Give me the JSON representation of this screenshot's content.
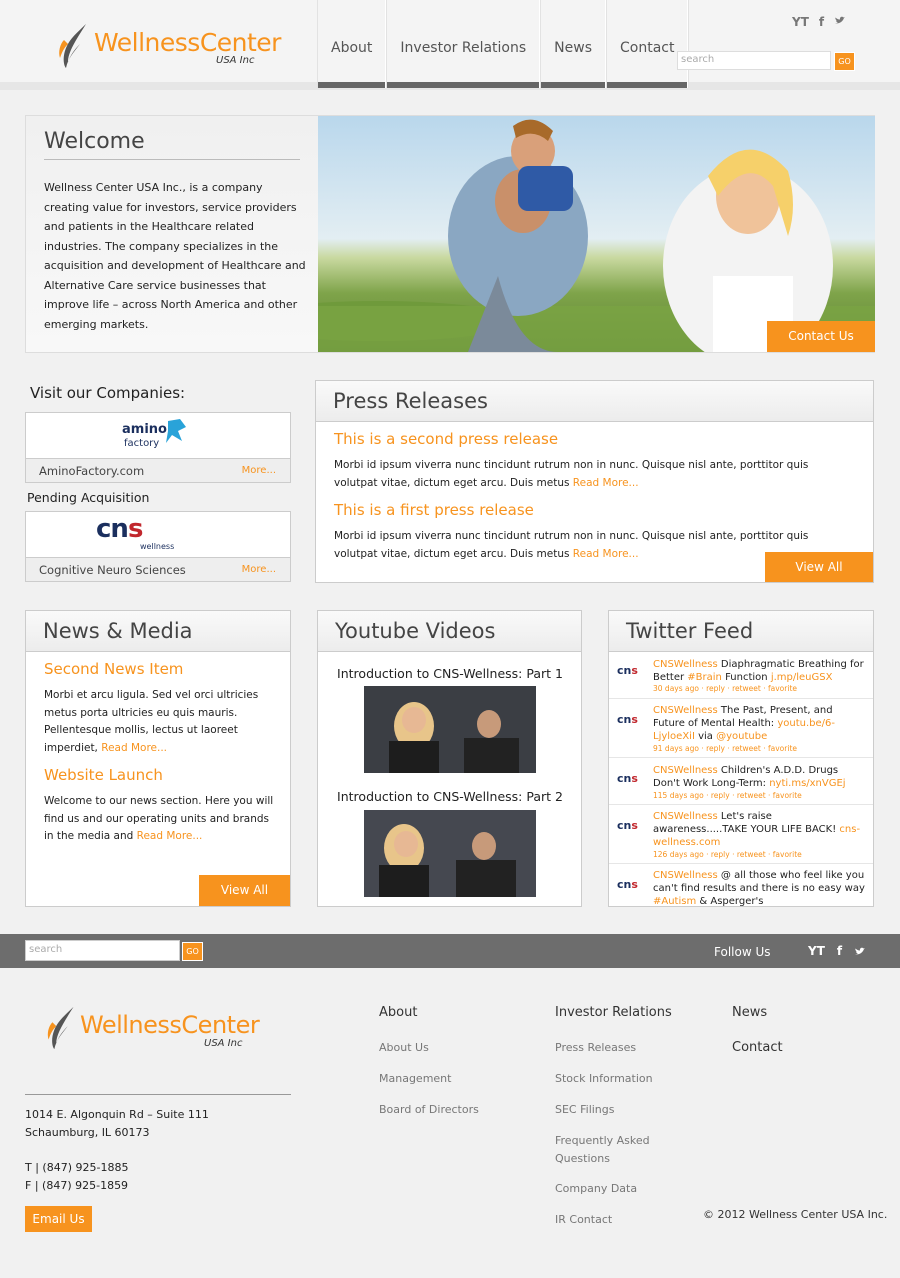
{
  "brand": {
    "name_part1": "Wellness",
    "name_part2": "Center",
    "sub": "USA Inc"
  },
  "nav": {
    "items": [
      "About",
      "Investor Relations",
      "News",
      "Contact"
    ]
  },
  "header": {
    "social": [
      "YT",
      "f",
      "t"
    ],
    "search_placeholder": "search",
    "go_label": "GO"
  },
  "welcome": {
    "title": "Welcome",
    "body": "Wellness Center USA Inc., is a company creating value for investors, service providers and patients in the Healthcare related industries. The company specializes in the acquisition and development of Healthcare and Alternative Care service businesses that improve life – across North America and other emerging markets.",
    "contact_label": "Contact Us"
  },
  "companies": {
    "title": "Visit our Companies:",
    "pending_label": "Pending Acquisition",
    "items": [
      {
        "name": "AminoFactory.com",
        "more": "More...",
        "logo_text": "amino factory"
      },
      {
        "name": "Cognitive Neuro Sciences",
        "more": "More...",
        "logo_text": "cns",
        "logo_sub": "wellness"
      }
    ]
  },
  "press": {
    "title": "Press Releases",
    "items": [
      {
        "title": "This is a second press release",
        "body": "Morbi id ipsum viverra nunc tincidunt rutrum non in nunc. Quisque nisl ante, porttitor quis volutpat vitae, dictum eget arcu. Duis metus ",
        "read_more": "Read More..."
      },
      {
        "title": "This is a first press release",
        "body": "Morbi id ipsum viverra nunc tincidunt rutrum non in nunc. Quisque nisl ante, porttitor quis volutpat vitae, dictum eget arcu. Duis metus ",
        "read_more": "Read More..."
      }
    ],
    "view_all": "View All"
  },
  "news": {
    "title": "News & Media",
    "items": [
      {
        "title": "Second News Item",
        "body": "Morbi et arcu ligula. Sed vel orci ultricies metus porta ultricies eu quis mauris. Pellentesque mollis, lectus ut laoreet imperdiet, ",
        "read_more": "Read More..."
      },
      {
        "title": "Website Launch",
        "body": "Welcome to our news section. Here you will find us and our operating units and brands in the media and ",
        "read_more": "Read More..."
      }
    ],
    "view_all": "View All"
  },
  "videos": {
    "title": "Youtube Videos",
    "items": [
      {
        "title": "Introduction to CNS-Wellness: Part 1"
      },
      {
        "title": "Introduction to CNS-Wellness: Part 2"
      }
    ]
  },
  "twitter": {
    "title": "Twitter Feed",
    "logo_text": "cns",
    "tweets": [
      {
        "user": "CNSWellness",
        "text": " Diaphragmatic Breathing for Better ",
        "tag": "#Brain",
        "text2": " Function ",
        "link": "j.mp/leuGSX",
        "meta": "30 days ago · reply · retweet · favorite"
      },
      {
        "user": "CNSWellness",
        "text": " The Past, Present, and Future of Mental Health: ",
        "link": "youtu.be/6-LjyloeXiI",
        "text2": " via ",
        "tag": "@youtube",
        "meta": "91 days ago · reply · retweet · favorite"
      },
      {
        "user": "CNSWellness",
        "text": " Children's A.D.D. Drugs Don't Work Long-Term: ",
        "link": "nyti.ms/xnVGEj",
        "meta": "115 days ago · reply · retweet · favorite"
      },
      {
        "user": "CNSWellness",
        "text": " Let's raise awareness.....TAKE YOUR LIFE BACK! ",
        "link": "cns-wellness.com",
        "meta": "126 days ago · reply · retweet · favorite"
      },
      {
        "user": "CNSWellness",
        "text": " @ all those who feel like you can't find results and there is no easy way ",
        "tag": "#Autism",
        "text2": " & Asperger's",
        "meta": ""
      }
    ]
  },
  "footer": {
    "search_placeholder": "search",
    "go_label": "GO",
    "follow_label": "Follow Us",
    "social": [
      "YT",
      "f",
      "t"
    ],
    "columns": [
      {
        "head": "About",
        "links": [
          "About Us",
          "Management",
          "Board of Directors"
        ]
      },
      {
        "head": "Investor Relations",
        "links": [
          "Press Releases",
          "Stock Information",
          "SEC Filings",
          "Frequently Asked Questions",
          "Company Data",
          "IR Contact"
        ]
      },
      {
        "head": "News",
        "links": []
      },
      {
        "head": "Contact",
        "links": []
      }
    ],
    "address_line1": "1014 E. Algonquin Rd – Suite 111",
    "address_line2": "Schaumburg, IL 60173",
    "phone": "T | (847) 925-1885",
    "fax": "F | (847) 925-1859",
    "email_label": "Email Us",
    "copyright": "© 2012 Wellness Center USA Inc."
  },
  "colors": {
    "accent": "#f7931e",
    "dark_bar": "#6d6d6d",
    "nav_underline": "#666666",
    "cns_red": "#c1272d",
    "cns_blue": "#1b2f5e"
  }
}
